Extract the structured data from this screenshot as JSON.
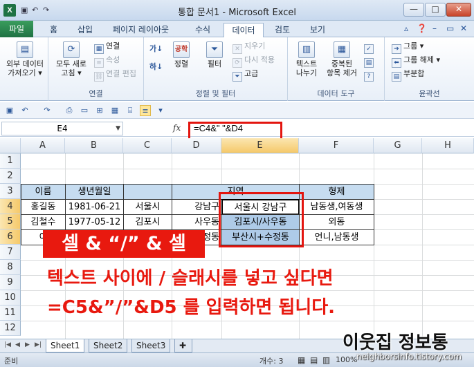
{
  "window": {
    "title": "통합 문서1 - Microsoft Excel",
    "app_icon": "X",
    "buttons": {
      "minimize": "—",
      "maximize": "□",
      "close": "✕"
    }
  },
  "ribbon_tabs": [
    "파일",
    "홈",
    "삽입",
    "페이지 레이아웃",
    "수식",
    "데이터",
    "검토",
    "보기"
  ],
  "ribbon_active_tab": "데이터",
  "ribbon": {
    "external_data": {
      "line1": "외부 데이터",
      "line2": "가져오기 ▾"
    },
    "refresh_all": {
      "line1": "모두 새로",
      "line2": "고침 ▾"
    },
    "connections": "연결",
    "properties": "속성",
    "edit_links": "연결 편집",
    "connections_group": "연결",
    "sort_az": "가",
    "sort_za": "하",
    "sort_big": "공학",
    "sort": "정렬",
    "filter": "필터",
    "clear": "지우기",
    "reapply": "다시 적용",
    "advanced": "고급",
    "sort_filter_group": "정렬 및 필터",
    "text_to_columns": {
      "line1": "텍스트",
      "line2": "나누기"
    },
    "remove_duplicates": {
      "line1": "중복된",
      "line2": "항목 제거"
    },
    "data_tools_group": "데이터 도구",
    "group": "그룹 ▾",
    "ungroup": "그룹 해제 ▾",
    "subtotal": "부분합",
    "outline_group": "윤곽선"
  },
  "formula_bar": {
    "name_box": "E4",
    "fx": "fx",
    "formula": "=C4&\" \"&D4"
  },
  "columns": [
    "A",
    "B",
    "C",
    "D",
    "E",
    "F",
    "G",
    "H"
  ],
  "rows": [
    "1",
    "2",
    "3",
    "4",
    "5",
    "6",
    "7",
    "8",
    "9",
    "10",
    "11",
    "12"
  ],
  "cells": {
    "a3": "이름",
    "b3": "생년월일",
    "d3": "지역",
    "f3": "형제",
    "a4": "홍길동",
    "b4": "1981-06-21",
    "c4": "서울시",
    "d4": "강남구",
    "e4": "서울시 강남구",
    "f4": "남동생,여동생",
    "a5": "김철수",
    "b5": "1977-05-12",
    "c5": "김포시",
    "d5": "사우동",
    "e5": "김포시/사우동",
    "f5": "외동",
    "a6": "이",
    "d6": "정동",
    "e6": "부산시+수정동",
    "f6": "언니,남동생"
  },
  "annotation": {
    "banner": "셀 & “/” & 셀",
    "line1": "텍스트 사이에 / 슬래시를 넣고 싶다면",
    "line2": "=C5&”/”&D5 를 입력하면 됩니다."
  },
  "sheet_tabs": [
    "Sheet1",
    "Sheet2",
    "Sheet3"
  ],
  "status": {
    "ready": "준비",
    "count": "개수: 3",
    "zoom": "100%"
  },
  "watermark": {
    "name": "이웃집 정보통",
    "url": "neighborsinfo.tistory.com"
  },
  "colors": {
    "accent_red": "#e8190f",
    "selection_blue": "#aecbe8",
    "header_blue": "#c6dcf0",
    "excel_green": "#1f7244"
  }
}
